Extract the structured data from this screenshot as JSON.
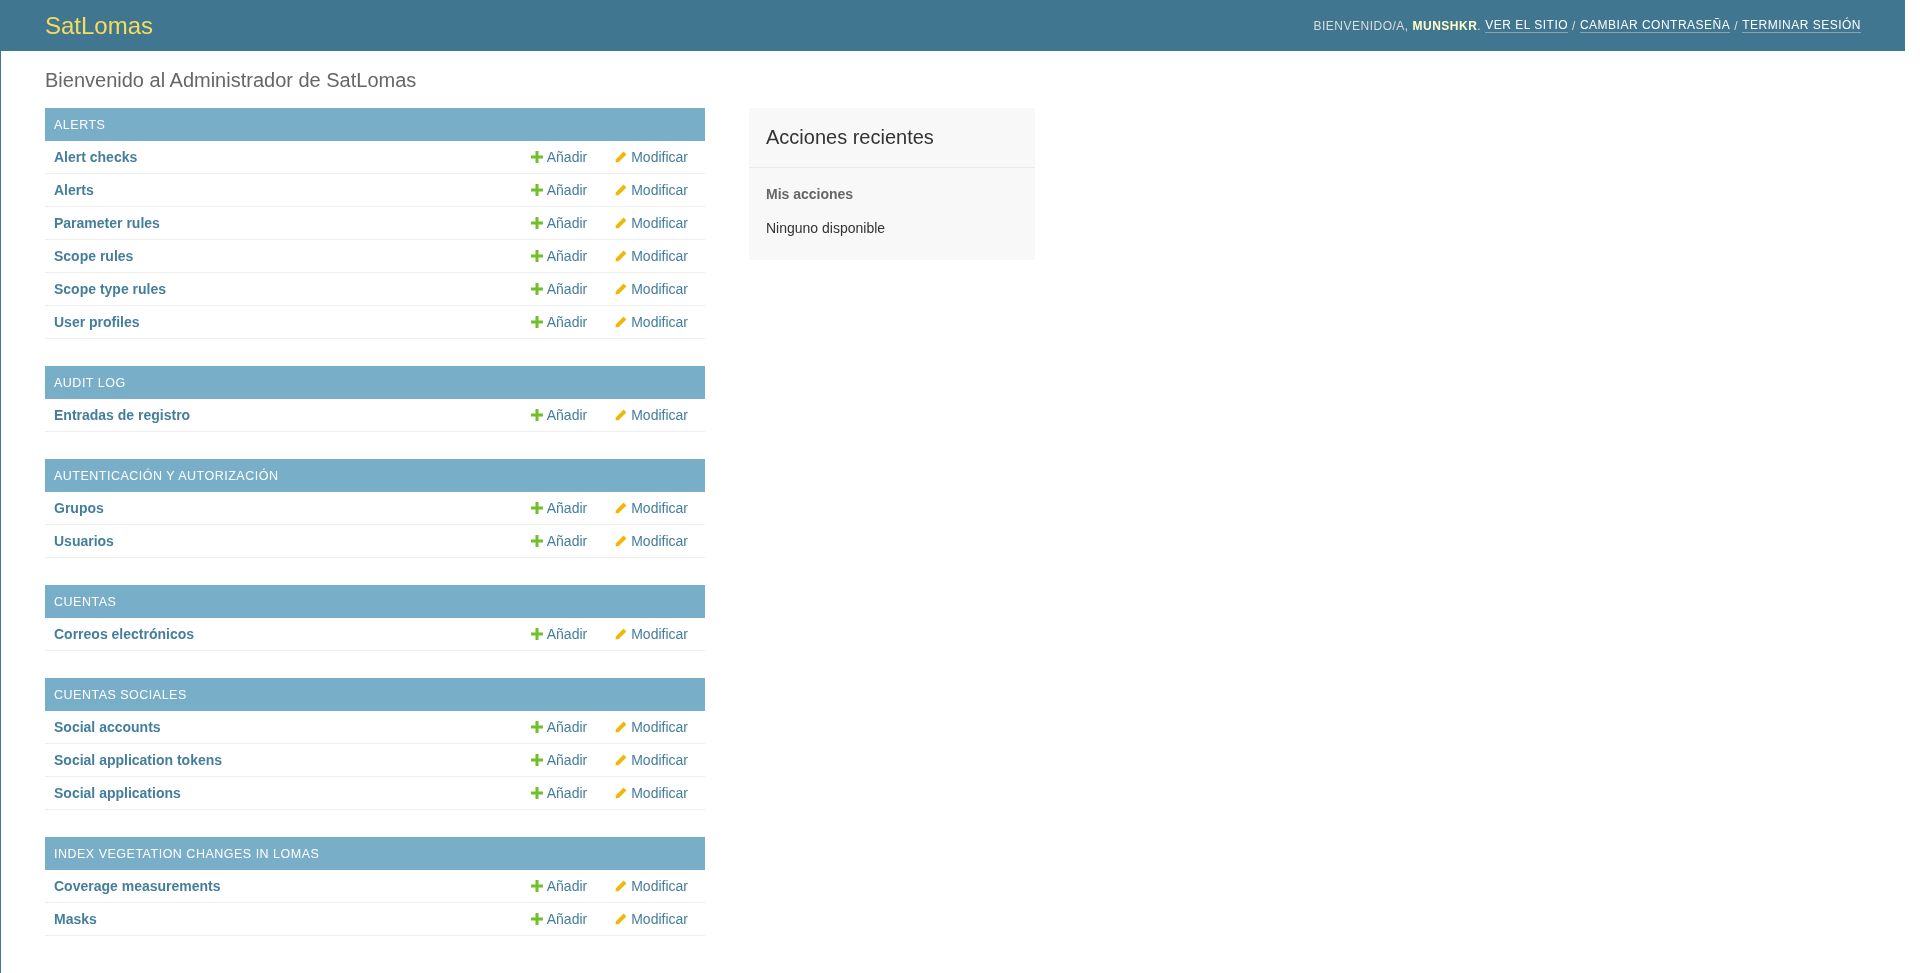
{
  "header": {
    "brand": "SatLomas",
    "user_tools": [
      {
        "kind": "text",
        "text": "BIENVENIDO/A, **MUNSHKR**."
      },
      {
        "kind": "link",
        "text": "VER EL SITIO"
      },
      {
        "kind": "separator",
        "text": "/"
      },
      {
        "kind": "link",
        "text": "CAMBIAR CONTRASEÑA"
      },
      {
        "kind": "separator",
        "text": "/"
      },
      {
        "kind": "link",
        "text": "TERMINAR SESIÓN"
      }
    ]
  },
  "title": "Bienvenido al Administrador de SatLomas",
  "modules": [
    {
      "caption": "ALERTS",
      "models": [
        {
          "name": "Alert checks",
          "add": "Añadir",
          "change": "Modificar"
        },
        {
          "name": "Alerts",
          "add": "Añadir",
          "change": "Modificar"
        },
        {
          "name": "Parameter rules",
          "add": "Añadir",
          "change": "Modificar"
        },
        {
          "name": "Scope rules",
          "add": "Añadir",
          "change": "Modificar"
        },
        {
          "name": "Scope type rules",
          "add": "Añadir",
          "change": "Modificar"
        },
        {
          "name": "User profiles",
          "add": "Añadir",
          "change": "Modificar"
        }
      ]
    },
    {
      "caption": "AUDIT LOG",
      "models": [
        {
          "name": "Entradas de registro",
          "add": "Añadir",
          "change": "Modificar"
        }
      ]
    },
    {
      "caption": "AUTENTICACIÓN Y AUTORIZACIÓN",
      "models": [
        {
          "name": "Grupos",
          "add": "Añadir",
          "change": "Modificar"
        },
        {
          "name": "Usuarios",
          "add": "Añadir",
          "change": "Modificar"
        }
      ]
    },
    {
      "caption": "CUENTAS",
      "models": [
        {
          "name": "Correos electrónicos",
          "add": "Añadir",
          "change": "Modificar"
        }
      ]
    },
    {
      "caption": "CUENTAS SOCIALES",
      "models": [
        {
          "name": "Social accounts",
          "add": "Añadir",
          "change": "Modificar"
        },
        {
          "name": "Social application tokens",
          "add": "Añadir",
          "change": "Modificar"
        },
        {
          "name": "Social applications",
          "add": "Añadir",
          "change": "Modificar"
        }
      ]
    },
    {
      "caption": "INDEX VEGETATION CHANGES IN LOMAS",
      "models": [
        {
          "name": "Coverage measurements",
          "add": "Añadir",
          "change": "Modificar"
        },
        {
          "name": "Masks",
          "add": "Añadir",
          "change": "Modificar"
        }
      ]
    }
  ],
  "recent_actions": {
    "title": "Acciones recientes",
    "subtitle": "Mis acciones",
    "empty_text": "Ninguno disponible"
  }
}
